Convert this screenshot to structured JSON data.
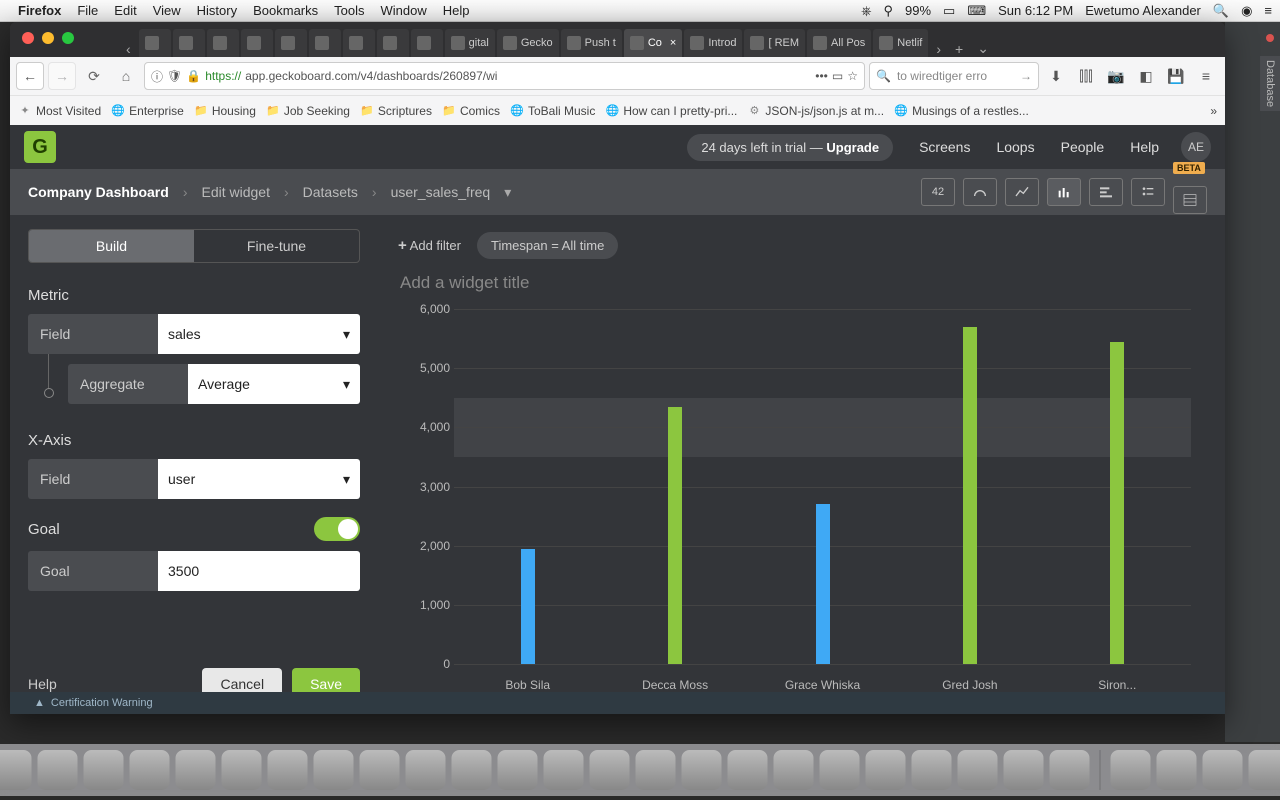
{
  "mac_menu": {
    "app": "Firefox",
    "items": [
      "File",
      "Edit",
      "View",
      "History",
      "Bookmarks",
      "Tools",
      "Window",
      "Help"
    ],
    "battery": "99%",
    "clock": "Sun 6:12 PM",
    "user": "Ewetumo Alexander"
  },
  "tabs": [
    {
      "label": ""
    },
    {
      "label": ""
    },
    {
      "label": ""
    },
    {
      "label": ""
    },
    {
      "label": ""
    },
    {
      "label": ""
    },
    {
      "label": ""
    },
    {
      "label": ""
    },
    {
      "label": ""
    },
    {
      "label": "gital"
    },
    {
      "label": "Gecko"
    },
    {
      "label": "Push t"
    },
    {
      "label": "Co",
      "active": true
    },
    {
      "label": "Introd"
    },
    {
      "label": "[ REM"
    },
    {
      "label": "All Pos"
    },
    {
      "label": "Netlif"
    }
  ],
  "url": "https://app.geckoboard.com/v4/dashboards/260897/wi",
  "search_box": "to wiredtiger erro",
  "bookmarks": [
    "Most Visited",
    "Enterprise",
    "Housing",
    "Job Seeking",
    "Scriptures",
    "Comics",
    "ToBali Music",
    "How can I pretty-pri...",
    "JSON-js/json.js at m...",
    "Musings of a restles..."
  ],
  "app_top": {
    "trial": "24 days left in trial — ",
    "trial_cta": "Upgrade",
    "links": [
      "Screens",
      "Loops",
      "People",
      "Help"
    ],
    "avatar": "AE"
  },
  "breadcrumbs": [
    "Company Dashboard",
    "Edit widget",
    "Datasets",
    "user_sales_freq"
  ],
  "viz_number": "42",
  "beta": "BETA",
  "sidebar": {
    "tabs": [
      "Build",
      "Fine-tune"
    ],
    "metric_label": "Metric",
    "field_label": "Field",
    "metric_field": "sales",
    "aggregate_label": "Aggregate",
    "aggregate_value": "Average",
    "xaxis_label": "X-Axis",
    "xaxis_field": "user",
    "goal_label": "Goal",
    "goal_field_label": "Goal",
    "goal_value": "3500",
    "help": "Help",
    "cancel": "Cancel",
    "save": "Save"
  },
  "filters": {
    "add": "Add filter",
    "timespan": "Timespan = All time"
  },
  "chart_title_placeholder": "Add a widget title",
  "cert_warning": "Certification Warning",
  "db_panel": "Database",
  "chart_data": {
    "type": "bar",
    "categories": [
      "Bob Sila",
      "Decca Moss",
      "Grace Whiska",
      "Gred Josh",
      "Siron..."
    ],
    "values": [
      1950,
      4350,
      2700,
      5700,
      5450
    ],
    "colors": [
      "#3fa9f5",
      "#8cc63f",
      "#3fa9f5",
      "#8cc63f",
      "#8cc63f"
    ],
    "ylim": [
      0,
      6000
    ],
    "yticks": [
      0,
      1000,
      2000,
      3000,
      4000,
      5000,
      6000
    ],
    "goal": 3500,
    "ylabel": "",
    "xlabel": "",
    "title": ""
  }
}
